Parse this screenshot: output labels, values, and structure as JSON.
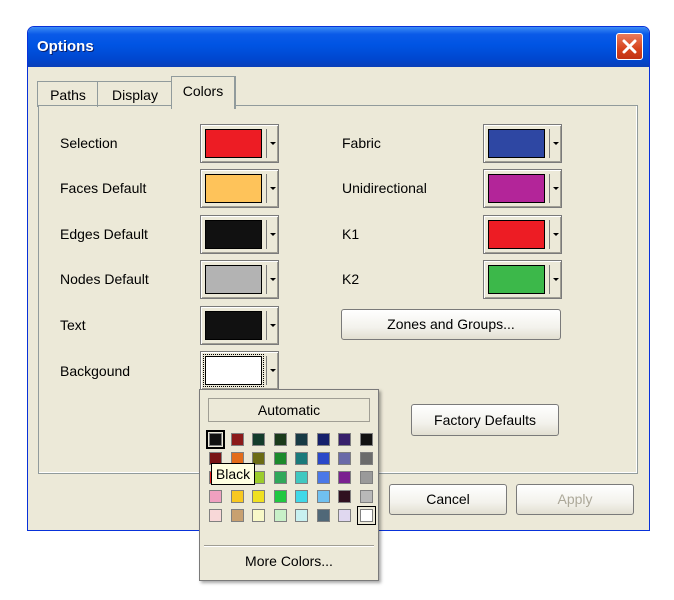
{
  "window": {
    "title": "Options"
  },
  "tabs": [
    {
      "label": "Paths"
    },
    {
      "label": "Display"
    },
    {
      "label": "Colors",
      "active": true
    }
  ],
  "left_rows": [
    {
      "label": "Selection",
      "color": "#ed1c24"
    },
    {
      "label": "Faces Default",
      "color": "#fec35a"
    },
    {
      "label": "Edges Default",
      "color": "#111111"
    },
    {
      "label": "Nodes Default",
      "color": "#b3b3b3"
    },
    {
      "label": "Text",
      "color": "#111111"
    },
    {
      "label": "Backgound",
      "color": "#ffffff"
    }
  ],
  "right_rows": [
    {
      "label": "Fabric",
      "color": "#2e47a3"
    },
    {
      "label": "Unidirectional",
      "color": "#b32599"
    },
    {
      "label": "K1",
      "color": "#ed1c24"
    },
    {
      "label": "K2",
      "color": "#3cb84a"
    }
  ],
  "buttons": {
    "zones": "Zones and Groups...",
    "factory": "Factory Defaults",
    "cancel": "Cancel",
    "apply": "Apply"
  },
  "color_popup": {
    "automatic_label": "Automatic",
    "more_label": "More Colors...",
    "tooltip": "Black",
    "rows": [
      [
        "#111111",
        "#8b1a1a",
        "#143c2c",
        "#1a3a1a",
        "#173a44",
        "#15206b",
        "#37206b",
        "#111111"
      ],
      [
        "#7a1515",
        "#e36c1a",
        "#6b6b15",
        "#1c8a2c",
        "#1a7a7a",
        "#2a48c8",
        "#6a6aa8",
        "#6b6b6b"
      ],
      [
        "#e31c1c",
        "#f0a020",
        "#9ccc2c",
        "#30a85a",
        "#40c8c0",
        "#4a78e8",
        "#7a2090",
        "#9a9a9a"
      ],
      [
        "#f0a0c0",
        "#f8c820",
        "#f0e020",
        "#20c840",
        "#40d8e8",
        "#70c0f0",
        "#301020",
        "#b8b8b8"
      ],
      [
        "#f8d8d8",
        "#c8a070",
        "#f8f8c8",
        "#c8f0c8",
        "#c8f0f0",
        "#506878",
        "#e0d8f0",
        "#ffffff"
      ]
    ]
  }
}
